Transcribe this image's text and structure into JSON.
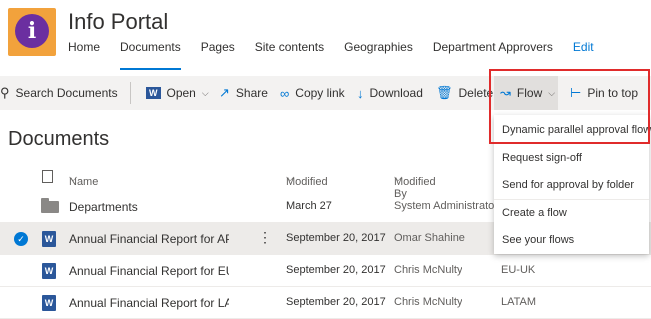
{
  "header": {
    "logo_letter": "i",
    "site_title": "Info Portal",
    "nav": [
      "Home",
      "Documents",
      "Pages",
      "Site contents",
      "Geographies",
      "Department Approvers",
      "Edit"
    ]
  },
  "commandbar": {
    "search": "Search Documents",
    "open": "Open",
    "share": "Share",
    "copy_link": "Copy link",
    "download": "Download",
    "delete": "Delete",
    "flow": "Flow",
    "pin": "Pin to top"
  },
  "page_title": "Documents",
  "columns": {
    "name": "Name",
    "modified": "Modified",
    "modified_by": "Modified By"
  },
  "rows": [
    {
      "name": "Departments",
      "modified": "March 27",
      "modified_by": "System Administrator",
      "extra": ""
    },
    {
      "name": "Annual Financial Report for APA...",
      "modified": "September 20, 2017",
      "modified_by": "Omar Shahine",
      "extra": ""
    },
    {
      "name": "Annual Financial Report for EU ...",
      "modified": "September 20, 2017",
      "modified_by": "Chris McNulty",
      "extra": "EU-UK"
    },
    {
      "name": "Annual Financial Report for LAT...",
      "modified": "September 20, 2017",
      "modified_by": "Chris McNulty",
      "extra": "LATAM"
    }
  ],
  "flow_menu": [
    "Dynamic parallel approval flow",
    "Request sign-off",
    "Send for approval by folder",
    "Create a flow",
    "See your flows"
  ],
  "colors": {
    "accent": "#0078d4",
    "highlight": "#e02b2b",
    "logo_bg": "#f2a23c",
    "logo_circle": "#6b2fa0"
  }
}
